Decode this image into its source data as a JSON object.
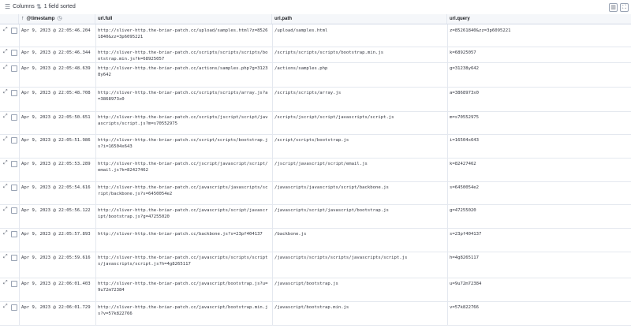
{
  "toolbar": {
    "columns_label": "Columns",
    "sorted_label": "1 field sorted",
    "columns_icon": "list-icon",
    "sort_icon": "sort-icon"
  },
  "table": {
    "columns": [
      {
        "key": "timestamp",
        "label": "@timestamp"
      },
      {
        "key": "url_full",
        "label": "url.full"
      },
      {
        "key": "url_path",
        "label": "url.path"
      },
      {
        "key": "url_query",
        "label": "url.query"
      }
    ],
    "rows": [
      {
        "timestamp": "Apr 9, 2023 @ 22:05:46.204",
        "url_full": "http://sliver-http.the-briar-patch.cc/upload/samples.html?z=85261840&zz=3p6095221",
        "url_path": "/upload/samples.html",
        "url_query": "z=85261840&zz=3p6095221"
      },
      {
        "timestamp": "Apr 9, 2023 @ 22:05:46.344",
        "url_full": "http://sliver-http.the-briar-patch.cc/scripts/scripts/scripts/bootstrap.min.js?k=68925057",
        "url_path": "/scripts/scripts/scripts/bootstrap.min.js",
        "url_query": "k=68925057"
      },
      {
        "timestamp": "Apr 9, 2023 @ 22:05:48.639",
        "url_full": "http://sliver-http.the-briar-patch.cc/actions/samples.php?g=31238y642",
        "url_path": "/actions/samples.php",
        "url_query": "g=31238y642"
      },
      {
        "timestamp": "Apr 9, 2023 @ 22:05:48.708",
        "url_full": "http://sliver-http.the-briar-patch.cc/scripts/scripts/array.js?a=3868973x0",
        "url_path": "/scripts/scripts/array.js",
        "url_query": "a=3868973x0"
      },
      {
        "timestamp": "Apr 9, 2023 @ 22:05:50.651",
        "url_full": "http://sliver-http.the-briar-patch.cc/scripts/jscript/script/javascripts/script.js?m=s70552975",
        "url_path": "/scripts/jscript/script/javascripts/script.js",
        "url_query": "m=s70552975"
      },
      {
        "timestamp": "Apr 9, 2023 @ 22:05:51.986",
        "url_full": "http://sliver-http.the-briar-patch.cc/script/scripts/bootstrap.js?i=16504x643",
        "url_path": "/script/scripts/bootstrap.js",
        "url_query": "i=16504x643"
      },
      {
        "timestamp": "Apr 9, 2023 @ 22:05:53.289",
        "url_full": "http://sliver-http.the-briar-patch.cc/jscript/javascript/script/email.js?k=82427462",
        "url_path": "/jscript/javascript/script/email.js",
        "url_query": "k=82427462"
      },
      {
        "timestamp": "Apr 9, 2023 @ 22:05:54.616",
        "url_full": "http://sliver-http.the-briar-patch.cc/javascripts/javascripts/script/backbone.js?s=6450054e2",
        "url_path": "/javascripts/javascripts/script/backbone.js",
        "url_query": "s=6450054e2"
      },
      {
        "timestamp": "Apr 9, 2023 @ 22:05:56.122",
        "url_full": "http://sliver-http.the-briar-patch.cc/javascripts/script/javascript/bootstrap.js?g=47255020",
        "url_path": "/javascripts/script/javascript/bootstrap.js",
        "url_query": "g=47255020"
      },
      {
        "timestamp": "Apr 9, 2023 @ 22:05:57.893",
        "url_full": "http://sliver-http.the-briar-patch.cc/backbone.js?s=23pf404137",
        "url_path": "/backbone.js",
        "url_query": "s=23pf404137"
      },
      {
        "timestamp": "Apr 9, 2023 @ 22:05:59.616",
        "url_full": "http://sliver-http.the-briar-patch.cc/javascripts/scripts/scripts/javascripts/script.js?h=4g8265117",
        "url_path": "/javascripts/scripts/scripts/javascripts/script.js",
        "url_query": "h=4g8265117"
      },
      {
        "timestamp": "Apr 9, 2023 @ 22:06:01.403",
        "url_full": "http://sliver-http.the-briar-patch.cc/javascript/bootstrap.js?u=9u72m72384",
        "url_path": "/javascript/bootstrap.js",
        "url_query": "u=9u72m72384"
      },
      {
        "timestamp": "Apr 9, 2023 @ 22:06:01.729",
        "url_full": "http://sliver-http.the-briar-patch.cc/javascript/bootstrap.min.js?v=57k822766",
        "url_path": "/javascript/bootstrap.min.js",
        "url_query": "v=57k822766"
      }
    ]
  }
}
